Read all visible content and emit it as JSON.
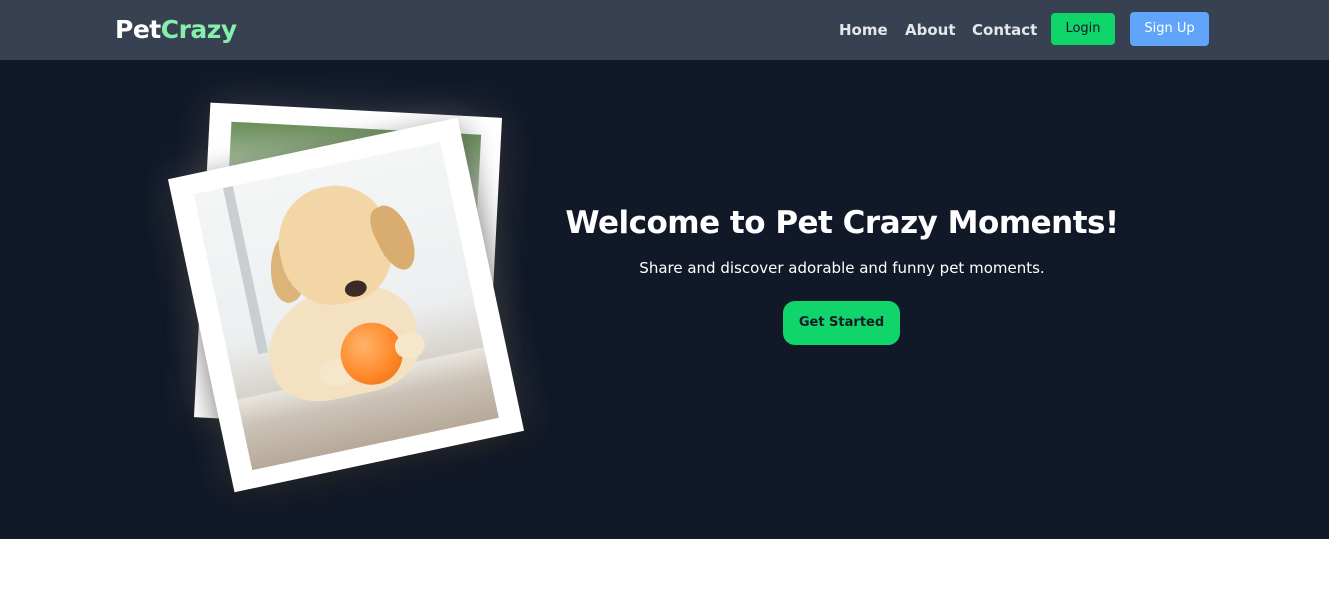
{
  "navbar": {
    "logo": {
      "part1": "Pet",
      "part2": "Crazy"
    },
    "links": {
      "home": "Home",
      "about": "About",
      "contact": "Contact"
    },
    "login_label": "Login",
    "signup_label": "Sign Up"
  },
  "hero": {
    "title": "Welcome to Pet Crazy Moments!",
    "subtitle": "Share and discover adorable and funny pet moments.",
    "cta_label": "Get Started",
    "image_icon": "puppy-photo"
  },
  "colors": {
    "navbar_bg": "#374151",
    "hero_bg": "#111827",
    "accent_green": "#10d56a",
    "logo_green": "#86efac",
    "signup_blue": "#60a5fa"
  }
}
